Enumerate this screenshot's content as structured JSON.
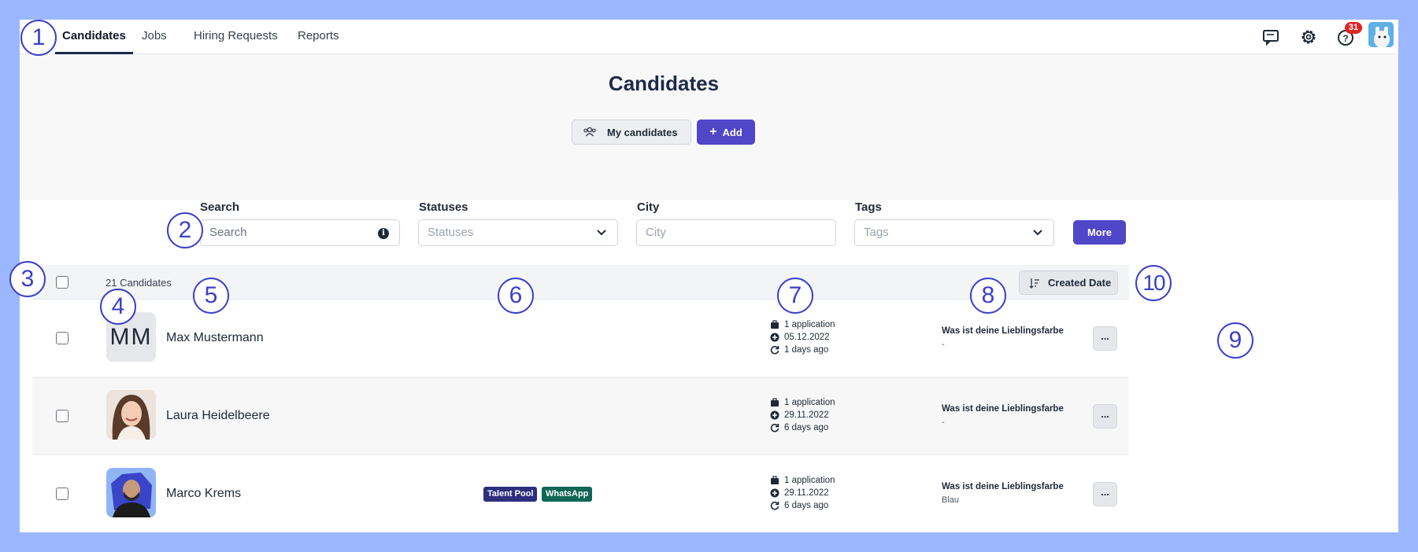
{
  "nav": {
    "tabs": [
      {
        "label": "Candidates",
        "active": true
      },
      {
        "label": "Jobs"
      },
      {
        "label": "Hiring Requests"
      },
      {
        "label": "Reports"
      }
    ],
    "notification_count": "31"
  },
  "header": {
    "title": "Candidates",
    "my_candidates_label": "My candidates",
    "add_label": "Add"
  },
  "filters": {
    "search": {
      "label": "Search",
      "placeholder": "Search"
    },
    "statuses": {
      "label": "Statuses",
      "placeholder": "Statuses"
    },
    "city": {
      "label": "City",
      "placeholder": "City"
    },
    "tags": {
      "label": "Tags",
      "placeholder": "Tags"
    },
    "more_label": "More"
  },
  "table": {
    "count_label": "21 Candidates",
    "sort_label": "Created Date",
    "rows": [
      {
        "initials": "MM",
        "name": "Max Mustermann",
        "tags": [],
        "applications": "1 application",
        "created": "05.12.2022",
        "updated": "1 days ago",
        "question": "Was ist deine Lieblingsfarbe",
        "answer": "-"
      },
      {
        "name": "Laura Heidelbeere",
        "tags": [],
        "applications": "1 application",
        "created": "29.11.2022",
        "updated": "6 days ago",
        "question": "Was ist deine Lieblingsfarbe",
        "answer": "-"
      },
      {
        "name": "Marco Krems",
        "tags": [
          {
            "label": "Talent Pool",
            "color": "#2d2f7e"
          },
          {
            "label": "WhatsApp",
            "color": "#0f6656"
          }
        ],
        "applications": "1 application",
        "created": "29.11.2022",
        "updated": "6 days ago",
        "question": "Was ist deine Lieblingsfarbe",
        "answer": "Blau"
      }
    ],
    "row_menu_label": "..."
  },
  "annotations": [
    "1",
    "2",
    "3",
    "4",
    "5",
    "6",
    "7",
    "8",
    "9",
    "10"
  ],
  "colors": {
    "accent": "#4f46c8",
    "annotation": "#3b3fc9",
    "frame": "#9bb7ff",
    "nav_active": "#1e2a4a"
  }
}
